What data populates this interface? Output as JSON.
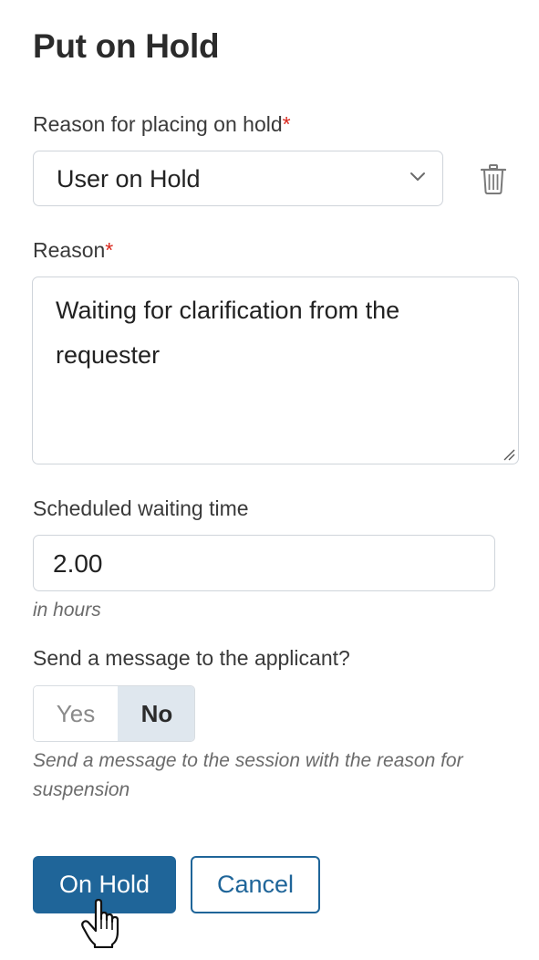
{
  "dialog": {
    "title": "Put on Hold"
  },
  "hold_reason": {
    "label": "Reason for placing on hold",
    "required_mark": "*",
    "selected_value": "User on Hold"
  },
  "reason": {
    "label": "Reason",
    "required_mark": "*",
    "value": "Waiting for clarification from the requester"
  },
  "waiting_time": {
    "label": "Scheduled waiting time",
    "value": "2.00",
    "hint": "in hours"
  },
  "send_message": {
    "label": "Send a message to the applicant?",
    "options": [
      "Yes",
      "No"
    ],
    "selected": "No",
    "hint": "Send a message to the session with the reason for suspension"
  },
  "actions": {
    "primary_label": "On Hold",
    "secondary_label": "Cancel"
  },
  "icons": {
    "select": "chevron-down-icon",
    "delete": "trash-icon",
    "resize": "resize-handle-icon",
    "cursor": "hand-pointer-icon"
  },
  "colors": {
    "primary": "#1f6599",
    "required": "#d9261c",
    "toggle_selected_bg": "#dfe7ee"
  }
}
